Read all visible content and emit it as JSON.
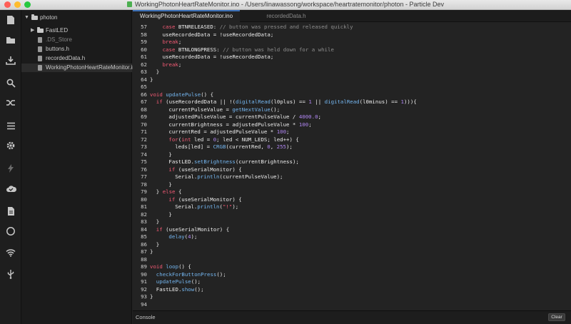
{
  "window": {
    "title": "WorkingPhotonHeartRateMonitor.ino - /Users/linawassong/workspace/heartratemonitor/photon - Particle Dev",
    "traffic_lights": [
      "#ff5f57",
      "#febc2e",
      "#28c840"
    ]
  },
  "activity_bar": {
    "icons": [
      "file-icon",
      "folder-icon",
      "download-icon",
      "search-icon",
      "shuffle-icon",
      "list-icon",
      "gear-icon",
      "flash-icon",
      "cloud-icon",
      "document-icon",
      "circle-icon",
      "wifi-icon",
      "usb-icon"
    ]
  },
  "tree": {
    "root": "photon",
    "items": [
      {
        "label": "FastLED",
        "type": "folder",
        "dim": false,
        "selected": false
      },
      {
        "label": ".DS_Store",
        "type": "file",
        "dim": true,
        "selected": false
      },
      {
        "label": "buttons.h",
        "type": "file",
        "dim": false,
        "selected": false
      },
      {
        "label": "recordedData.h",
        "type": "file",
        "dim": false,
        "selected": false
      },
      {
        "label": "WorkingPhotonHeartRateMonitor.ino",
        "type": "file",
        "dim": false,
        "selected": true
      }
    ]
  },
  "tabs": [
    {
      "label": "WorkingPhotonHeartRateMonitor.ino",
      "active": true
    },
    {
      "label": "recordedData.h",
      "active": false
    }
  ],
  "code": {
    "lines": [
      {
        "n": "57",
        "indent": 4,
        "tokens": [
          [
            "k",
            "case"
          ],
          [
            "t",
            " BTNRELEASED: "
          ],
          [
            "c",
            "// button was pressed and released quickly"
          ]
        ]
      },
      {
        "n": "58",
        "indent": 4,
        "tokens": [
          [
            "t",
            "useRecordedData = !useRecordedData;"
          ]
        ]
      },
      {
        "n": "59",
        "indent": 4,
        "tokens": [
          [
            "k",
            "break"
          ],
          [
            "t",
            ";"
          ]
        ]
      },
      {
        "n": "60",
        "indent": 4,
        "tokens": [
          [
            "k",
            "case"
          ],
          [
            "t",
            " BTNLONGPRESS: "
          ],
          [
            "c",
            "// button was held down for a while"
          ]
        ]
      },
      {
        "n": "61",
        "indent": 4,
        "tokens": [
          [
            "t",
            "useRecordedData = !useRecordedData;"
          ]
        ]
      },
      {
        "n": "62",
        "indent": 4,
        "tokens": [
          [
            "k",
            "break"
          ],
          [
            "t",
            ";"
          ]
        ]
      },
      {
        "n": "63",
        "indent": 2,
        "tokens": [
          [
            "t",
            "}"
          ]
        ]
      },
      {
        "n": "64",
        "indent": 0,
        "tokens": [
          [
            "t",
            "}"
          ]
        ]
      },
      {
        "n": "65",
        "indent": 0,
        "tokens": []
      },
      {
        "n": "66",
        "indent": 0,
        "tokens": [
          [
            "k",
            "void"
          ],
          [
            "t",
            " "
          ],
          [
            "f",
            "updatePulse"
          ],
          [
            "t",
            "() {"
          ]
        ]
      },
      {
        "n": "67",
        "indent": 2,
        "tokens": [
          [
            "k",
            "if"
          ],
          [
            "t",
            " (useRecordedData || !("
          ],
          [
            "f",
            "digitalRead"
          ],
          [
            "t",
            "(l0plus) == "
          ],
          [
            "n",
            "1"
          ],
          [
            "t",
            " || "
          ],
          [
            "f",
            "digitalRead"
          ],
          [
            "t",
            "(l0minus) == "
          ],
          [
            "n",
            "1"
          ],
          [
            "t",
            "))){"
          ]
        ]
      },
      {
        "n": "68",
        "indent": 6,
        "tokens": [
          [
            "t",
            "currentPulseValue = "
          ],
          [
            "f",
            "getNextValue"
          ],
          [
            "t",
            "();"
          ]
        ]
      },
      {
        "n": "69",
        "indent": 6,
        "tokens": [
          [
            "t",
            "adjustedPulseValue = currentPulseValue / "
          ],
          [
            "n",
            "4000.0"
          ],
          [
            "t",
            ";"
          ]
        ]
      },
      {
        "n": "70",
        "indent": 6,
        "tokens": [
          [
            "t",
            "currentBrightness = adjustedPulseValue * "
          ],
          [
            "n",
            "100"
          ],
          [
            "t",
            ";"
          ]
        ]
      },
      {
        "n": "71",
        "indent": 6,
        "tokens": [
          [
            "t",
            "currentRed = adjustedPulseValue * "
          ],
          [
            "n",
            "100"
          ],
          [
            "t",
            ";"
          ]
        ]
      },
      {
        "n": "72",
        "indent": 6,
        "tokens": [
          [
            "k",
            "for"
          ],
          [
            "t",
            "("
          ],
          [
            "k",
            "int"
          ],
          [
            "t",
            " led = "
          ],
          [
            "n",
            "0"
          ],
          [
            "t",
            "; led < NUM_LEDS; led++) {"
          ]
        ]
      },
      {
        "n": "73",
        "indent": 8,
        "tokens": [
          [
            "t",
            "leds[led] = "
          ],
          [
            "f",
            "CRGB"
          ],
          [
            "t",
            "(currentRed, "
          ],
          [
            "n",
            "0"
          ],
          [
            "t",
            ", "
          ],
          [
            "n",
            "255"
          ],
          [
            "t",
            ");"
          ]
        ]
      },
      {
        "n": "74",
        "indent": 6,
        "tokens": [
          [
            "t",
            "}"
          ]
        ]
      },
      {
        "n": "75",
        "indent": 6,
        "tokens": [
          [
            "t",
            "FastLED."
          ],
          [
            "f",
            "setBrightness"
          ],
          [
            "t",
            "(currentBrightness);"
          ]
        ]
      },
      {
        "n": "76",
        "indent": 6,
        "tokens": [
          [
            "k",
            "if"
          ],
          [
            "t",
            " (useSerialMonitor) {"
          ]
        ]
      },
      {
        "n": "77",
        "indent": 8,
        "tokens": [
          [
            "t",
            "Serial."
          ],
          [
            "f",
            "println"
          ],
          [
            "t",
            "(currentPulseValue);"
          ]
        ]
      },
      {
        "n": "78",
        "indent": 6,
        "tokens": [
          [
            "t",
            "}"
          ]
        ]
      },
      {
        "n": "79",
        "indent": 2,
        "tokens": [
          [
            "t",
            "} "
          ],
          [
            "k",
            "else"
          ],
          [
            "t",
            " {"
          ]
        ]
      },
      {
        "n": "80",
        "indent": 6,
        "tokens": [
          [
            "k",
            "if"
          ],
          [
            "t",
            " (useSerialMonitor) {"
          ]
        ]
      },
      {
        "n": "81",
        "indent": 8,
        "tokens": [
          [
            "t",
            "Serial."
          ],
          [
            "f",
            "println"
          ],
          [
            "t",
            "("
          ],
          [
            "k",
            "\"!\""
          ],
          [
            "t",
            ");"
          ]
        ]
      },
      {
        "n": "82",
        "indent": 6,
        "tokens": [
          [
            "t",
            "}"
          ]
        ]
      },
      {
        "n": "83",
        "indent": 2,
        "tokens": [
          [
            "t",
            "}"
          ]
        ]
      },
      {
        "n": "84",
        "indent": 2,
        "tokens": [
          [
            "k",
            "if"
          ],
          [
            "t",
            " (useSerialMonitor) {"
          ]
        ]
      },
      {
        "n": "85",
        "indent": 6,
        "tokens": [
          [
            "f",
            "delay"
          ],
          [
            "t",
            "("
          ],
          [
            "n",
            "4"
          ],
          [
            "t",
            ");"
          ]
        ]
      },
      {
        "n": "86",
        "indent": 2,
        "tokens": [
          [
            "t",
            "}"
          ]
        ]
      },
      {
        "n": "87",
        "indent": 0,
        "tokens": [
          [
            "t",
            "}"
          ]
        ]
      },
      {
        "n": "88",
        "indent": 0,
        "tokens": []
      },
      {
        "n": "89",
        "indent": 0,
        "tokens": [
          [
            "k",
            "void"
          ],
          [
            "t",
            " "
          ],
          [
            "f",
            "loop"
          ],
          [
            "t",
            "() {"
          ]
        ]
      },
      {
        "n": "90",
        "indent": 2,
        "tokens": [
          [
            "f",
            "checkForButtonPress"
          ],
          [
            "t",
            "();"
          ]
        ]
      },
      {
        "n": "91",
        "indent": 2,
        "tokens": [
          [
            "f",
            "updatePulse"
          ],
          [
            "t",
            "();"
          ]
        ]
      },
      {
        "n": "92",
        "indent": 2,
        "tokens": [
          [
            "t",
            "FastLED."
          ],
          [
            "f",
            "show"
          ],
          [
            "t",
            "();"
          ]
        ]
      },
      {
        "n": "93",
        "indent": 0,
        "tokens": [
          [
            "t",
            "}"
          ]
        ]
      },
      {
        "n": "94",
        "indent": 0,
        "tokens": []
      }
    ]
  },
  "console": {
    "title": "Console",
    "clear_label": "Clear"
  }
}
